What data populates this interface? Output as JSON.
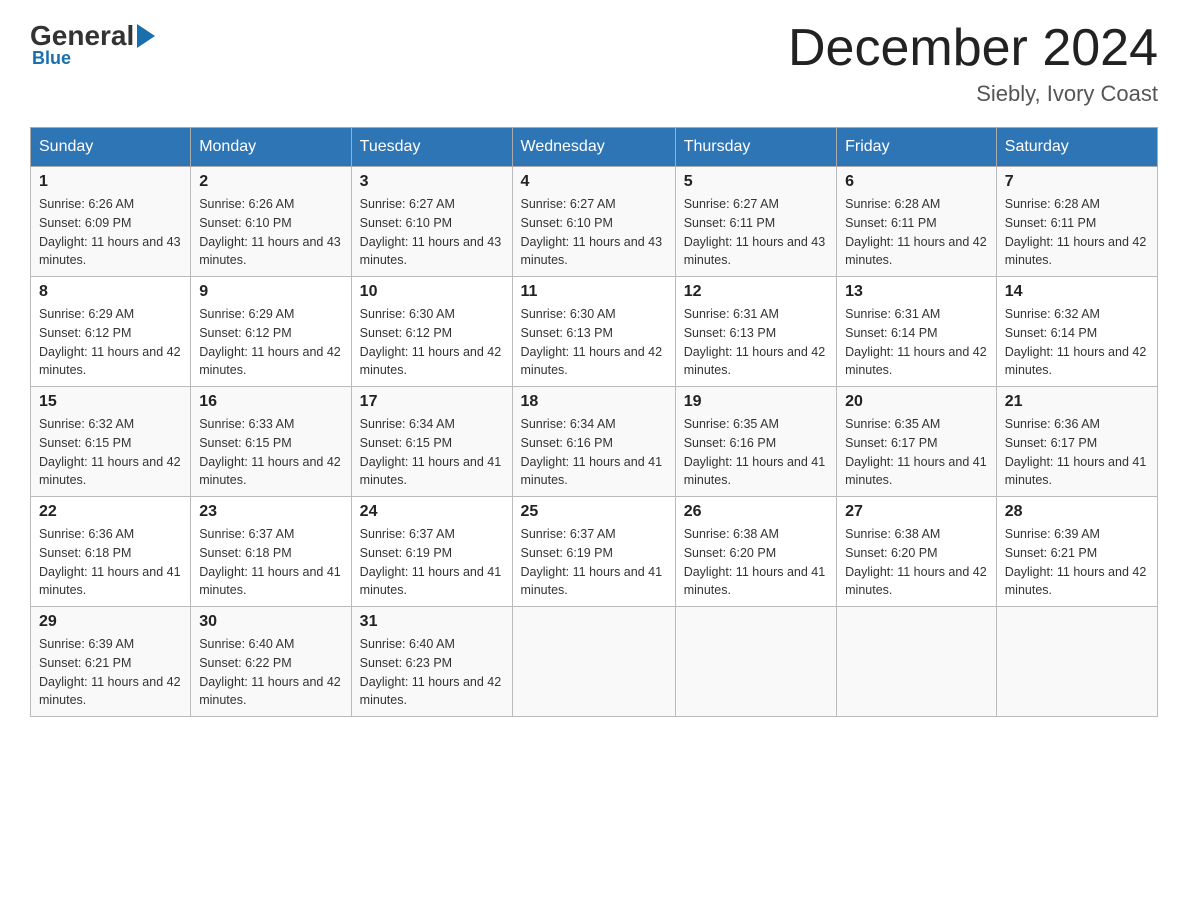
{
  "logo": {
    "general": "General",
    "blue": "Blue",
    "subtitle": "Blue"
  },
  "header": {
    "month_title": "December 2024",
    "location": "Siebly, Ivory Coast"
  },
  "weekdays": [
    "Sunday",
    "Monday",
    "Tuesday",
    "Wednesday",
    "Thursday",
    "Friday",
    "Saturday"
  ],
  "weeks": [
    [
      {
        "day": "1",
        "sunrise": "6:26 AM",
        "sunset": "6:09 PM",
        "daylight": "11 hours and 43 minutes."
      },
      {
        "day": "2",
        "sunrise": "6:26 AM",
        "sunset": "6:10 PM",
        "daylight": "11 hours and 43 minutes."
      },
      {
        "day": "3",
        "sunrise": "6:27 AM",
        "sunset": "6:10 PM",
        "daylight": "11 hours and 43 minutes."
      },
      {
        "day": "4",
        "sunrise": "6:27 AM",
        "sunset": "6:10 PM",
        "daylight": "11 hours and 43 minutes."
      },
      {
        "day": "5",
        "sunrise": "6:27 AM",
        "sunset": "6:11 PM",
        "daylight": "11 hours and 43 minutes."
      },
      {
        "day": "6",
        "sunrise": "6:28 AM",
        "sunset": "6:11 PM",
        "daylight": "11 hours and 42 minutes."
      },
      {
        "day": "7",
        "sunrise": "6:28 AM",
        "sunset": "6:11 PM",
        "daylight": "11 hours and 42 minutes."
      }
    ],
    [
      {
        "day": "8",
        "sunrise": "6:29 AM",
        "sunset": "6:12 PM",
        "daylight": "11 hours and 42 minutes."
      },
      {
        "day": "9",
        "sunrise": "6:29 AM",
        "sunset": "6:12 PM",
        "daylight": "11 hours and 42 minutes."
      },
      {
        "day": "10",
        "sunrise": "6:30 AM",
        "sunset": "6:12 PM",
        "daylight": "11 hours and 42 minutes."
      },
      {
        "day": "11",
        "sunrise": "6:30 AM",
        "sunset": "6:13 PM",
        "daylight": "11 hours and 42 minutes."
      },
      {
        "day": "12",
        "sunrise": "6:31 AM",
        "sunset": "6:13 PM",
        "daylight": "11 hours and 42 minutes."
      },
      {
        "day": "13",
        "sunrise": "6:31 AM",
        "sunset": "6:14 PM",
        "daylight": "11 hours and 42 minutes."
      },
      {
        "day": "14",
        "sunrise": "6:32 AM",
        "sunset": "6:14 PM",
        "daylight": "11 hours and 42 minutes."
      }
    ],
    [
      {
        "day": "15",
        "sunrise": "6:32 AM",
        "sunset": "6:15 PM",
        "daylight": "11 hours and 42 minutes."
      },
      {
        "day": "16",
        "sunrise": "6:33 AM",
        "sunset": "6:15 PM",
        "daylight": "11 hours and 42 minutes."
      },
      {
        "day": "17",
        "sunrise": "6:34 AM",
        "sunset": "6:15 PM",
        "daylight": "11 hours and 41 minutes."
      },
      {
        "day": "18",
        "sunrise": "6:34 AM",
        "sunset": "6:16 PM",
        "daylight": "11 hours and 41 minutes."
      },
      {
        "day": "19",
        "sunrise": "6:35 AM",
        "sunset": "6:16 PM",
        "daylight": "11 hours and 41 minutes."
      },
      {
        "day": "20",
        "sunrise": "6:35 AM",
        "sunset": "6:17 PM",
        "daylight": "11 hours and 41 minutes."
      },
      {
        "day": "21",
        "sunrise": "6:36 AM",
        "sunset": "6:17 PM",
        "daylight": "11 hours and 41 minutes."
      }
    ],
    [
      {
        "day": "22",
        "sunrise": "6:36 AM",
        "sunset": "6:18 PM",
        "daylight": "11 hours and 41 minutes."
      },
      {
        "day": "23",
        "sunrise": "6:37 AM",
        "sunset": "6:18 PM",
        "daylight": "11 hours and 41 minutes."
      },
      {
        "day": "24",
        "sunrise": "6:37 AM",
        "sunset": "6:19 PM",
        "daylight": "11 hours and 41 minutes."
      },
      {
        "day": "25",
        "sunrise": "6:37 AM",
        "sunset": "6:19 PM",
        "daylight": "11 hours and 41 minutes."
      },
      {
        "day": "26",
        "sunrise": "6:38 AM",
        "sunset": "6:20 PM",
        "daylight": "11 hours and 41 minutes."
      },
      {
        "day": "27",
        "sunrise": "6:38 AM",
        "sunset": "6:20 PM",
        "daylight": "11 hours and 42 minutes."
      },
      {
        "day": "28",
        "sunrise": "6:39 AM",
        "sunset": "6:21 PM",
        "daylight": "11 hours and 42 minutes."
      }
    ],
    [
      {
        "day": "29",
        "sunrise": "6:39 AM",
        "sunset": "6:21 PM",
        "daylight": "11 hours and 42 minutes."
      },
      {
        "day": "30",
        "sunrise": "6:40 AM",
        "sunset": "6:22 PM",
        "daylight": "11 hours and 42 minutes."
      },
      {
        "day": "31",
        "sunrise": "6:40 AM",
        "sunset": "6:23 PM",
        "daylight": "11 hours and 42 minutes."
      },
      null,
      null,
      null,
      null
    ]
  ]
}
